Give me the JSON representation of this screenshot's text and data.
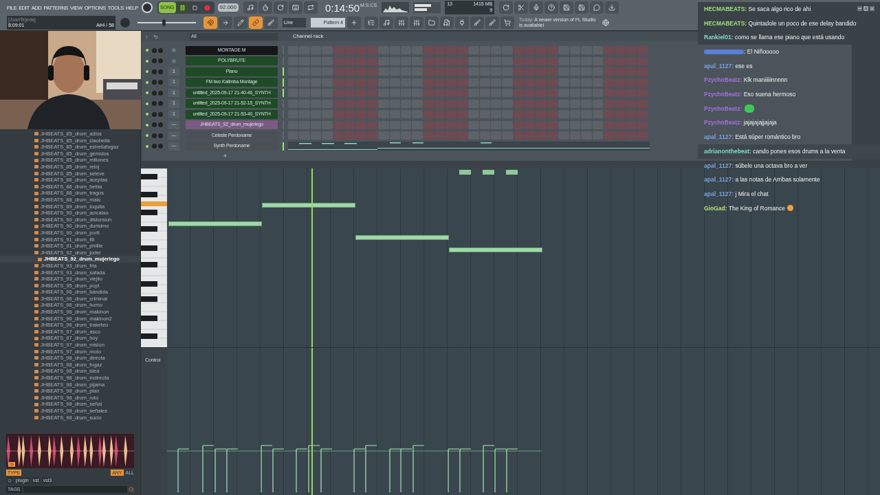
{
  "menu": [
    "FILE",
    "EDIT",
    "ADD",
    "PATTERNS",
    "VIEW",
    "OPTIONS",
    "TOOLS",
    "HELP"
  ],
  "hint_panel": {
    "title": "[JoanTejeda]",
    "time": "8:09:01",
    "note": "A#4 / 58"
  },
  "transport": {
    "mode": "SONG",
    "playing": true,
    "tempo": "92.000",
    "time": "0:14:50",
    "time_unit": "M:S:CS"
  },
  "pitch_slider": {
    "level": 0.45
  },
  "monitor": {
    "cpu": "13",
    "memory": "1415 MB",
    "polyphony": "9"
  },
  "snap": {
    "value": "Line"
  },
  "pattern": {
    "value": "Pattern 4"
  },
  "news": {
    "label": "Today:",
    "text": "A newer version of FL Studio is available!"
  },
  "browser": {
    "items": [
      {
        "label": "JHBEATS_85_drum_adios",
        "selected": false
      },
      {
        "label": "JHBEATS_85_drum_ciaobella",
        "selected": false
      },
      {
        "label": "JHBEATS_85_drum_estrellafugaz",
        "selected": false
      },
      {
        "label": "JHBEATS_85_drum_gemidos",
        "selected": false
      },
      {
        "label": "JHBEATS_85_drum_millones",
        "selected": false
      },
      {
        "label": "JHBEATS_85_drum_reloj",
        "selected": false
      },
      {
        "label": "JHBEATS_85_drum_seleve",
        "selected": false
      },
      {
        "label": "JHBEATS_86_drum_aceptas",
        "selected": false
      },
      {
        "label": "JHBEATS_86_drum_bebia",
        "selected": false
      },
      {
        "label": "JHBEATS_86_drum_tragos",
        "selected": false
      },
      {
        "label": "JHBEATS_88_drum_malo",
        "selected": false
      },
      {
        "label": "JHBEATS_89_drum_loquita",
        "selected": false
      },
      {
        "label": "JHBEATS_90_drum_acicalao",
        "selected": false
      },
      {
        "label": "JHBEATS_90_drum_distorsion",
        "selected": false
      },
      {
        "label": "JHBEATS_90_drum_durisimo",
        "selected": false
      },
      {
        "label": "JHBEATS_90_drum_porti",
        "selected": false
      },
      {
        "label": "JHBEATS_91_drum_fili",
        "selected": false
      },
      {
        "label": "JHBEATS_91_drum_phillie",
        "selected": false
      },
      {
        "label": "JHBEATS_92_drum_joder",
        "selected": false
      },
      {
        "label": "JHBEATS_92_drum_mujeriego",
        "selected": true
      },
      {
        "label": "JHBEATS_93_drum_fria",
        "selected": false
      },
      {
        "label": "JHBEATS_93_drum_safada",
        "selected": false
      },
      {
        "label": "JHBEATS_93_drum_viejilo",
        "selected": false
      },
      {
        "label": "JHBEATS_95_drum_popi",
        "selected": false
      },
      {
        "label": "JHBEATS_96_drum_bandida",
        "selected": false
      },
      {
        "label": "JHBEATS_96_drum_criminal",
        "selected": false
      },
      {
        "label": "JHBEATS_96_drum_humo",
        "selected": false
      },
      {
        "label": "JHBEATS_96_drum_makinon",
        "selected": false
      },
      {
        "label": "JHBEATS_96_drum_makinon2",
        "selected": false
      },
      {
        "label": "JHBEATS_96_drum_traketeo",
        "selected": false
      },
      {
        "label": "JHBEATS_97_drum_asco",
        "selected": false
      },
      {
        "label": "JHBEATS_97_drum_hoy",
        "selected": false
      },
      {
        "label": "JHBEATS_97_drum_mision",
        "selected": false
      },
      {
        "label": "JHBEATS_97_drum_moto",
        "selected": false
      },
      {
        "label": "JHBEATS_98_drum_directa",
        "selected": false
      },
      {
        "label": "JHBEATS_98_drum_fugaz",
        "selected": false
      },
      {
        "label": "JHBEATS_98_drum_idea",
        "selected": false
      },
      {
        "label": "JHBEATS_98_drum_indirecta",
        "selected": false
      },
      {
        "label": "JHBEATS_98_drum_pijama",
        "selected": false
      },
      {
        "label": "JHBEATS_98_drum_plan",
        "selected": false
      },
      {
        "label": "JHBEATS_98_drum_roto",
        "selected": false
      },
      {
        "label": "JHBEATS_98_drum_señal",
        "selected": false
      },
      {
        "label": "JHBEATS_98_drum_señales",
        "selected": false
      },
      {
        "label": "JHBEATS_98_drum_sucio",
        "selected": false
      }
    ],
    "type_button": "TYPE",
    "any_button": "ANY",
    "all_button": "ALL",
    "filters": [
      "plugin",
      "vst",
      "vst3"
    ],
    "tags_label": "TAGS"
  },
  "channel_rack": {
    "title": "Channel rack",
    "filter": "All",
    "channels": [
      {
        "name": "MONTAGE M",
        "color": "#141617",
        "lit": false,
        "kind": "steps"
      },
      {
        "name": "POLYBRUTE",
        "color": "#1e4a26",
        "lit": false,
        "kind": "steps"
      },
      {
        "name": "Piano",
        "color": "#1e4a26",
        "track": "1",
        "lit": true,
        "kind": "steps"
      },
      {
        "name": "FM two Kalimba Montage",
        "color": "#1e4a26",
        "track": "1",
        "lit": true,
        "kind": "steps"
      },
      {
        "name": "untitled_2025-09-17 21-40-46_SYNTH",
        "color": "#1e4a26",
        "track": "1",
        "lit": true,
        "kind": "steps"
      },
      {
        "name": "untitled_2025-09-17 21-52-15_SYNTH",
        "color": "#1e4a26",
        "track": "1",
        "lit": false,
        "kind": "steps"
      },
      {
        "name": "untitled_2025-09-17 21-53-40_SYNTH",
        "color": "#1e4a26",
        "track": "1",
        "lit": false,
        "kind": "steps"
      },
      {
        "name": "JHBEATS_92_drum_mujeriego",
        "color": "#7a5a82",
        "track": "—",
        "lit": false,
        "kind": "steps"
      },
      {
        "name": "Celeste Perdoname",
        "color": "#4a5056",
        "track": "—",
        "lit": false,
        "kind": "steps"
      },
      {
        "name": "Synth Perdoname",
        "color": "#4a5056",
        "track": "—",
        "lit": true,
        "kind": "pianoroll"
      }
    ]
  },
  "piano_roll": {
    "control_label": "Control"
  },
  "chat": {
    "messages": [
      {
        "kind": "text",
        "user": "HECMABEATS:",
        "color": "#9be07a",
        "text": "Se saca algo rico de ahi"
      },
      {
        "kind": "text",
        "user": "HECMABEATS:",
        "color": "#9be07a",
        "text": "Quintadole un poco de ese delay bandido"
      },
      {
        "kind": "text",
        "user": "Rankiel01:",
        "color": "#7fd9c4",
        "text": "como se llama ese piano que está usando"
      },
      {
        "kind": "blurred",
        "color": "#5b7fd6",
        "text": ": El Niñooooo"
      },
      {
        "kind": "text",
        "user": "apal_1127:",
        "color": "#7aa2e0",
        "text": "ese es"
      },
      {
        "kind": "text",
        "user": "PzychoBeatz:",
        "color": "#a56ee0",
        "text": "Klk maniiiiinnnnn"
      },
      {
        "kind": "text",
        "user": "PzychoBeatz:",
        "color": "#a56ee0",
        "text": "Eso suena hermoso"
      },
      {
        "kind": "emote",
        "user": "PzychoBeatz:",
        "color": "#a56ee0"
      },
      {
        "kind": "text",
        "user": "PzychoBeatz:",
        "color": "#a56ee0",
        "text": "jajajajajjajaja"
      },
      {
        "kind": "text",
        "user": "apal_1127:",
        "color": "#7aa2e0",
        "text": "Está súper romántico bro"
      },
      {
        "kind": "text",
        "user": "adrianonthebeat:",
        "color": "#7fd9c4",
        "text": "cando pones esos drums a la venta"
      },
      {
        "kind": "text",
        "user": "apal_1127:",
        "color": "#7aa2e0",
        "text": "súbele una octava bro a ver"
      },
      {
        "kind": "text",
        "user": "apal_1127:",
        "color": "#7aa2e0",
        "text": "a las notas de Arribas solamente"
      },
      {
        "kind": "text",
        "user": "apal_1127:",
        "color": "#7aa2e0",
        "text": "j Mira el chat"
      },
      {
        "kind": "text_emoji",
        "user": "GioGad:",
        "color": "#b6e07a",
        "text": "The King of Romance"
      }
    ]
  }
}
